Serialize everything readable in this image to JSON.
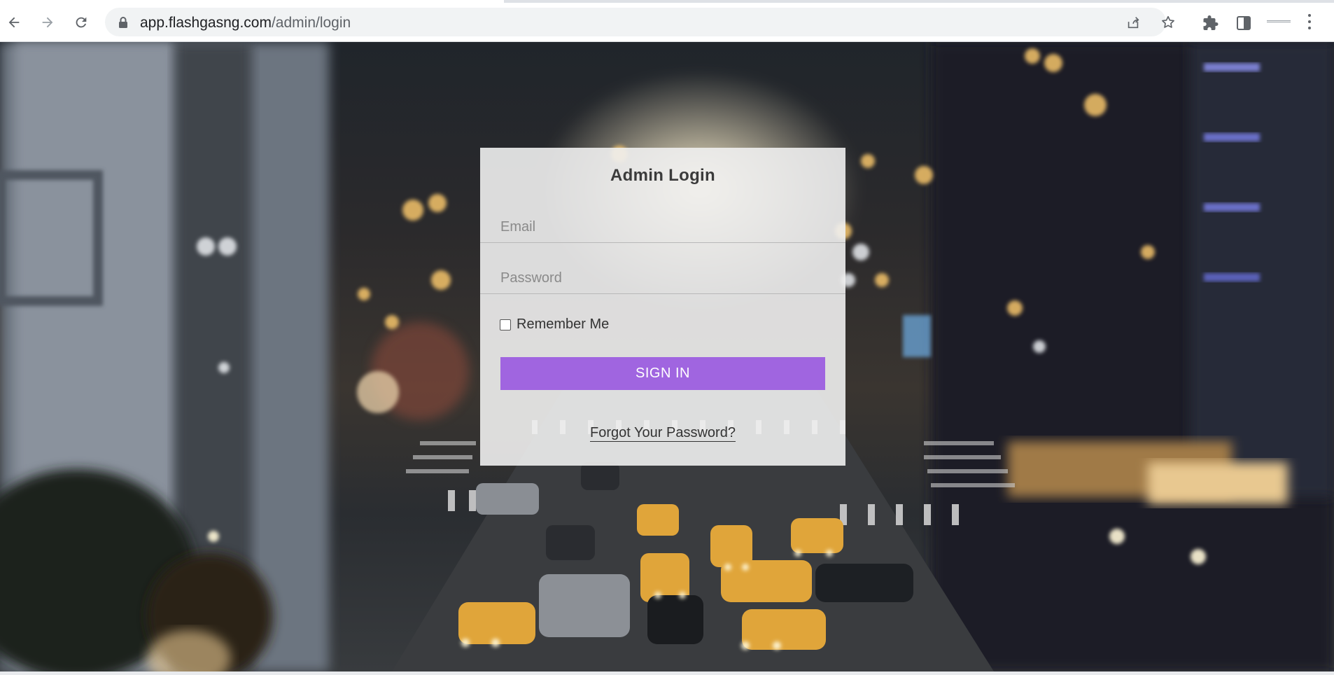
{
  "browser": {
    "url_host": "app.flashgasng.com",
    "url_path": "/admin/login",
    "icons": [
      "back-arrow-icon",
      "forward-arrow-icon",
      "reload-icon",
      "lock-icon",
      "share-icon",
      "bookmark-star-icon",
      "extensions-icon",
      "side-panel-icon",
      "profile-icon",
      "kebab-menu-icon"
    ]
  },
  "login": {
    "title": "Admin Login",
    "email_placeholder": "Email",
    "password_placeholder": "Password",
    "remember_label": "Remember Me",
    "remember_checked": false,
    "signin_label": "SIGN IN",
    "forgot_label": "Forgot Your Password?"
  },
  "colors": {
    "accent": "#a065e0",
    "card_bg": "#f0f0f0"
  }
}
